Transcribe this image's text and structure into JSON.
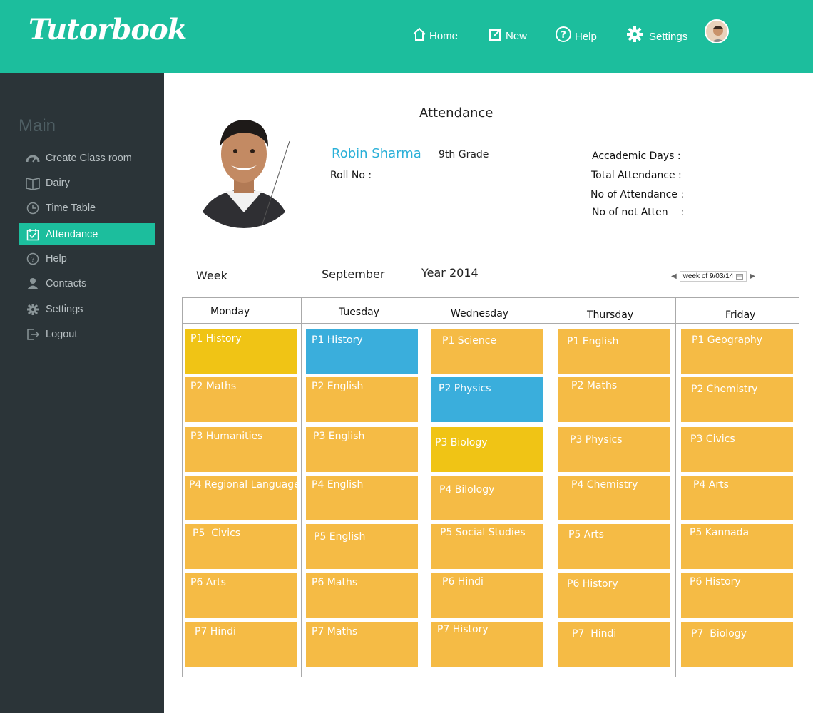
{
  "app": {
    "logo": "Tutorbook"
  },
  "nav": {
    "home": "Home",
    "new": "New",
    "help": "Help",
    "settings": "Settings"
  },
  "sidebar": {
    "title": "Main",
    "items": [
      {
        "label": "Create Class room",
        "icon": "dashboard-icon"
      },
      {
        "label": "Dairy",
        "icon": "book-icon"
      },
      {
        "label": "Time Table",
        "icon": "clock-icon"
      },
      {
        "label": "Attendance",
        "icon": "calendar-check-icon",
        "active": true
      },
      {
        "label": "Help",
        "icon": "question-icon"
      },
      {
        "label": "Contacts",
        "icon": "user-icon"
      },
      {
        "label": "Settings",
        "icon": "gear-icon"
      },
      {
        "label": "Logout",
        "icon": "logout-icon"
      }
    ]
  },
  "main": {
    "title": "Attendance",
    "student": {
      "name": "Robin Sharma",
      "grade": "9th Grade",
      "roll_label": "Roll No :"
    },
    "stats": {
      "academic_days": "Accademic Days :",
      "total_attendance": "Total Attendance :",
      "no_of_attendance": "No of Attendance :",
      "no_of_not_atten": "No of not Atten    :"
    },
    "week_label": "Week",
    "month": "September",
    "year": "Year 2014",
    "week_picker": "week of 9/03/14"
  },
  "timetable": {
    "days": [
      "Monday",
      "Tuesday",
      "Wednesday",
      "Thursday",
      "Friday"
    ],
    "periods": [
      [
        "P1 History",
        "P2 Maths",
        "P3 Humanities",
        "P4 Regional Language",
        "P5  Civics",
        "P6 Arts",
        "P7 Hindi"
      ],
      [
        "P1 History",
        "P2 English",
        "P3 English",
        "P4 English",
        "P5 English",
        "P6 Maths",
        "P7 Maths"
      ],
      [
        "P1 Science",
        "P2 Physics",
        "P3 Biology",
        "P4 Bilology",
        "P5 Social Studies",
        "P6 Hindi",
        "P7 History"
      ],
      [
        "P1 English",
        "P2 Maths",
        "P3 Physics",
        "P4 Chemistry",
        "P5 Arts",
        "P6 History",
        "P7  Hindi"
      ],
      [
        "P1 Geography",
        "P2 Chemistry",
        "P3 Civics",
        "P4 Arts",
        "P5 Kannada",
        "P6 History",
        "P7  Biology"
      ]
    ],
    "colors": {
      "default": "#f5bb45",
      "blue": "#3aaedc",
      "yellow": "#f0c415"
    }
  }
}
